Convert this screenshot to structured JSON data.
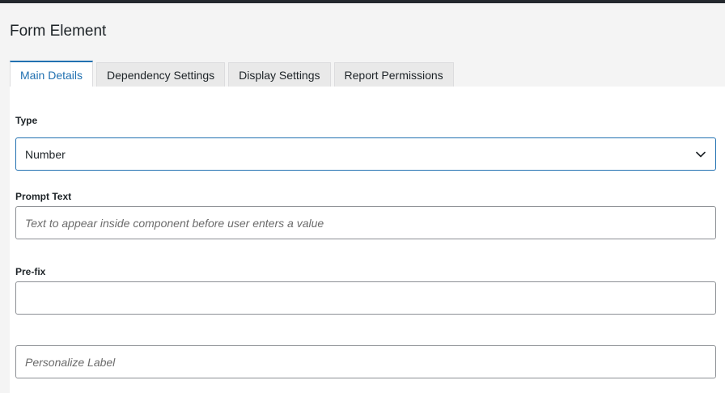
{
  "page": {
    "title": "Form Element"
  },
  "tabs": [
    {
      "label": "Main Details",
      "active": true
    },
    {
      "label": "Dependency Settings",
      "active": false
    },
    {
      "label": "Display Settings",
      "active": false
    },
    {
      "label": "Report Permissions",
      "active": false
    }
  ],
  "form": {
    "type": {
      "label": "Type",
      "value": "Number"
    },
    "prompt_text": {
      "label": "Prompt Text",
      "placeholder": "Text to appear inside component before user enters a value",
      "value": ""
    },
    "prefix": {
      "label": "Pre-fix",
      "placeholder": "",
      "value": ""
    },
    "personalize": {
      "placeholder": "Personalize Label",
      "value": ""
    }
  },
  "colors": {
    "accent": "#2271b1",
    "topbar": "#23282d",
    "background": "#f4f4f4"
  },
  "icons": {
    "select": "chevron-down-icon"
  }
}
